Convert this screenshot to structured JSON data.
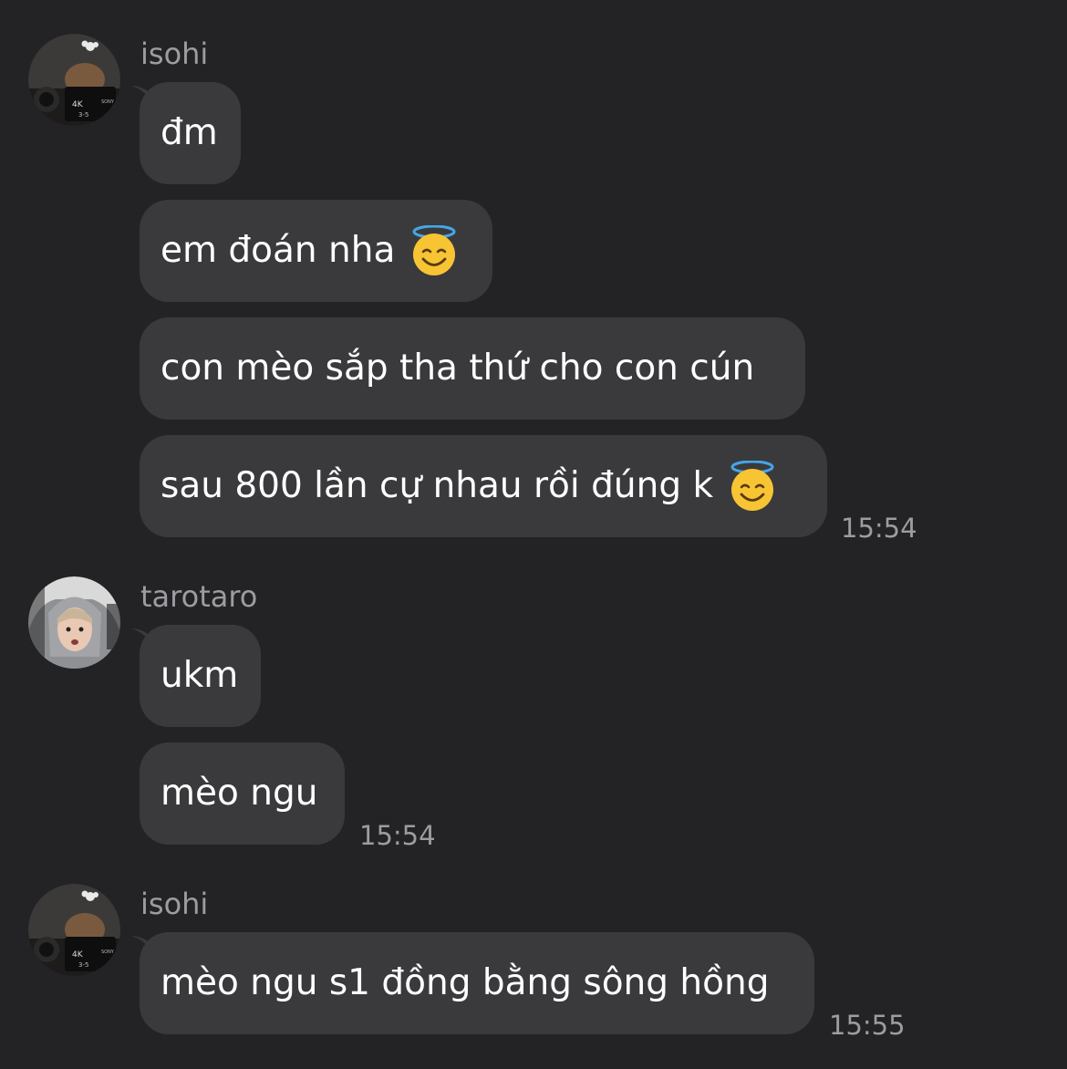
{
  "groups": [
    {
      "sender": "isohi",
      "avatar_icon": "user-avatar-camera-photo",
      "messages": [
        {
          "text": "đm"
        },
        {
          "text": "em đoán nha",
          "emoji": "smiling-face-with-halo-icon"
        },
        {
          "text": "con mèo sắp tha thứ cho con cún"
        },
        {
          "text": "sau 800 lần cự nhau rồi đúng k",
          "emoji": "smiling-face-with-halo-icon"
        }
      ],
      "time": "15:54"
    },
    {
      "sender": "tarotaro",
      "avatar_icon": "user-avatar-hoodie-photo",
      "messages": [
        {
          "text": "ukm"
        },
        {
          "text": "mèo ngu"
        }
      ],
      "time": "15:54"
    },
    {
      "sender": "isohi",
      "avatar_icon": "user-avatar-camera-photo",
      "messages": [
        {
          "text": "mèo ngu s1 đồng bằng sông hồng"
        }
      ],
      "time": "15:55"
    }
  ],
  "colors": {
    "background": "#232325",
    "bubble": "#3a3a3d",
    "meta_text": "#9c9ca1",
    "message_text": "#ffffff"
  }
}
